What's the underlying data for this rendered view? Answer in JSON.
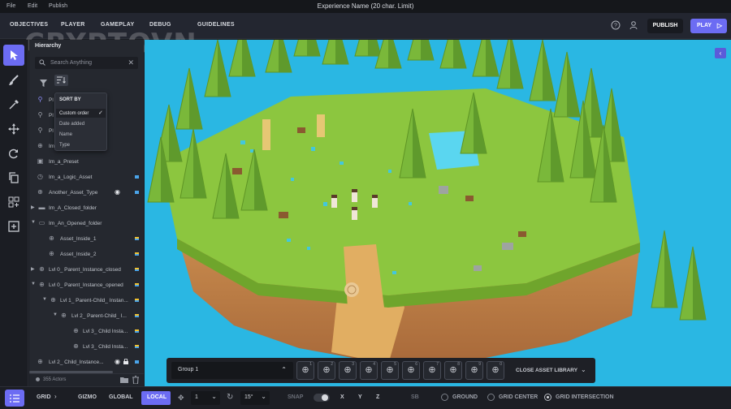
{
  "menubar": {
    "items": [
      "File",
      "Edit",
      "Publish"
    ],
    "title": "Experience Name (20 char. Limit)"
  },
  "watermark": "CRYPTOVN",
  "topbar": {
    "tabs": [
      "OBJECTIVES",
      "PLAYER",
      "GAMEPLAY",
      "DEBUG",
      "GUIDELINES"
    ],
    "publish": "PUBLISH",
    "play": "PLAY"
  },
  "hierarchy": {
    "title": "Hierarchy",
    "search_placeholder": "Search Anything",
    "sort_menu": {
      "heading": "SORT BY",
      "options": [
        "Custom order",
        "Date added",
        "Name",
        "Type"
      ],
      "selected": "Custom order"
    },
    "rows": [
      {
        "label": "Pl",
        "icon": "location-pin-icon"
      },
      {
        "label": "Pl",
        "icon": "location-pin-icon"
      },
      {
        "label": "Pl",
        "icon": "location-pin-icon"
      },
      {
        "label": "Im",
        "icon": "crosshair-icon"
      },
      {
        "label": "Im_a_Preset",
        "icon": "preset-icon"
      },
      {
        "label": "Im_a_Logic_Asset",
        "icon": "logic-icon"
      },
      {
        "label": "Another_Asset_Type",
        "icon": "crosshair-icon"
      },
      {
        "label": "Im_A_Closed_folder",
        "icon": "folder-icon"
      },
      {
        "label": "Im_An_Opened_folder",
        "icon": "folder-open-icon"
      },
      {
        "label": "Asset_Inside_1",
        "icon": "crosshair-icon"
      },
      {
        "label": "Asset_Inside_2",
        "icon": "crosshair-icon"
      },
      {
        "label": "Lvl 0_ Parent_Instance_closed",
        "icon": "crosshair-icon"
      },
      {
        "label": "Lvl 0_ Parent_Instance_opened",
        "icon": "crosshair-icon"
      },
      {
        "label": "Lvl 1_ Parent-Child_ Instan...",
        "icon": "crosshair-icon"
      },
      {
        "label": "Lvl 2_ Parent-Child_ I...",
        "icon": "crosshair-icon"
      },
      {
        "label": "Lvl 3_ Child Insta...",
        "icon": "crosshair-icon"
      },
      {
        "label": "Lvl 3_ Child Insta...",
        "icon": "crosshair-icon"
      },
      {
        "label": "Lvl 2_ Child_Instance...",
        "icon": "crosshair-icon"
      }
    ],
    "footer": "355 Actors"
  },
  "asset_library": {
    "group": "Group 1",
    "slot_numbers": [
      "1",
      "2",
      "3",
      "4",
      "5",
      "6",
      "7",
      "8",
      "9",
      "0"
    ],
    "close_label": "CLOSE ASSET LIBRARY"
  },
  "bottombar": {
    "grid": "GRID",
    "gizmo": "GIZMO",
    "global": "GLOBAL",
    "local": "LOCAL",
    "move_step": "1",
    "rotate_step": "15°",
    "snap": "SNAP",
    "x": "X",
    "y": "Y",
    "z": "Z",
    "sb": "SB",
    "ground": "GROUND",
    "grid_center": "GRID CENTER",
    "grid_intersection": "GRID INTERSECTION"
  },
  "colors": {
    "accent": "#6c6cf3",
    "sky": "#2ab7e3",
    "grass": "#8cc63f",
    "dirt": "#c8894a"
  }
}
